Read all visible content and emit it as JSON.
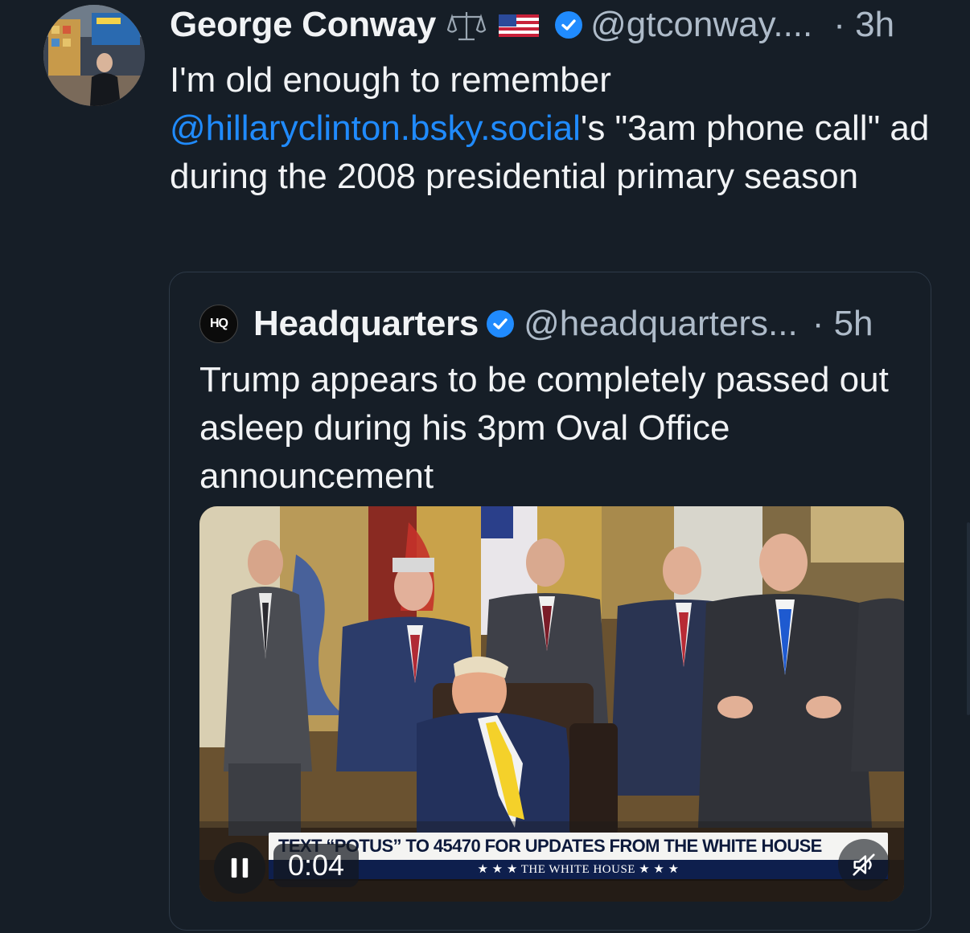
{
  "post": {
    "author_name": "George Conway",
    "author_emojis": "⚖️🇺🇸",
    "handle": "@gtconway....",
    "time": "· 3h",
    "text_before": "I'm old enough to remember ",
    "mention": "@hillaryclinton.bsky.social",
    "text_after": "'s \"3am phone call\" ad during the 2008 presidential primary season"
  },
  "quote": {
    "avatar_text": "HQ",
    "author_name": "Headquarters",
    "handle": "@headquarters...",
    "time": "· 5h",
    "text": "Trump appears to be completely passed out asleep during his 3pm Oval Office announcement",
    "video": {
      "timestamp": "0:04",
      "chyron_main": "TEXT “POTUS” TO 45470 FOR UPDATES FROM THE WHITE HOUSE",
      "chyron_sub": "★ ★ ★  THE WHITE HOUSE  ★ ★ ★",
      "playing": true,
      "muted": true
    }
  },
  "colors": {
    "background": "#161e27",
    "link": "#208bfe",
    "muted_text": "#aebbc9",
    "verified": "#208bfe"
  },
  "icons": [
    "verified-badge-icon",
    "pause-icon",
    "muted-speaker-icon"
  ]
}
